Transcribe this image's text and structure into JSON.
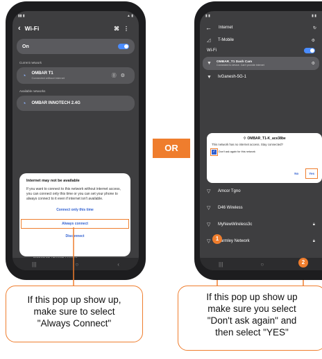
{
  "left_phone": {
    "header_title": "Wi-Fi",
    "on_label": "On",
    "current_section": "Current network",
    "current_network": {
      "name": "OMBAR T1",
      "status": "Connected without internet"
    },
    "available_section": "Available networks",
    "available_network": {
      "name": "OMBAR INNOTECH 2.4G"
    },
    "behind_row": "DIRECT-ED-HP M479 LaserJet",
    "dialog": {
      "title": "Internet may not be available",
      "message": "If you want to connect to this network without internet access, you can connect only this time or you can set your phone to always connect to it even if internet isn't available.",
      "option_once": "Connect only this time",
      "option_always": "Always connect",
      "option_disconnect": "Disconnect"
    }
  },
  "or_label": "OR",
  "right_phone": {
    "header_title": "Internet",
    "carrier": "T-Mobile",
    "wifi_label": "Wi-Fi",
    "connected_network": {
      "name": "OMBAR_T1 Dash Cam",
      "status": "Connected to device. Can't provide internet"
    },
    "partial_network": "IvGanesh-5G-1",
    "dialog": {
      "title": "OMBAR_T1-K_ace38be",
      "message": "This network has no internet access. Stay connected?",
      "checkbox_label": "Don't ask again for this network",
      "no_label": "No",
      "yes_label": "Yes"
    },
    "networks": [
      "Amcor Tgno",
      "D46 Wireless",
      "MyNewWireless3c",
      "Parmley Network"
    ]
  },
  "callouts": {
    "left": [
      "If this pop up show up,",
      "make sure to select",
      "\"Always Connect\""
    ],
    "right": [
      "If this pop up show up",
      "make sure you select",
      "\"Don't ask again\" and",
      "then select \"YES\""
    ]
  },
  "badges": [
    "1",
    "2"
  ],
  "colors": {
    "accent": "#ef7d2d",
    "link": "#2f5fd0",
    "toggle": "#4a8cff"
  }
}
